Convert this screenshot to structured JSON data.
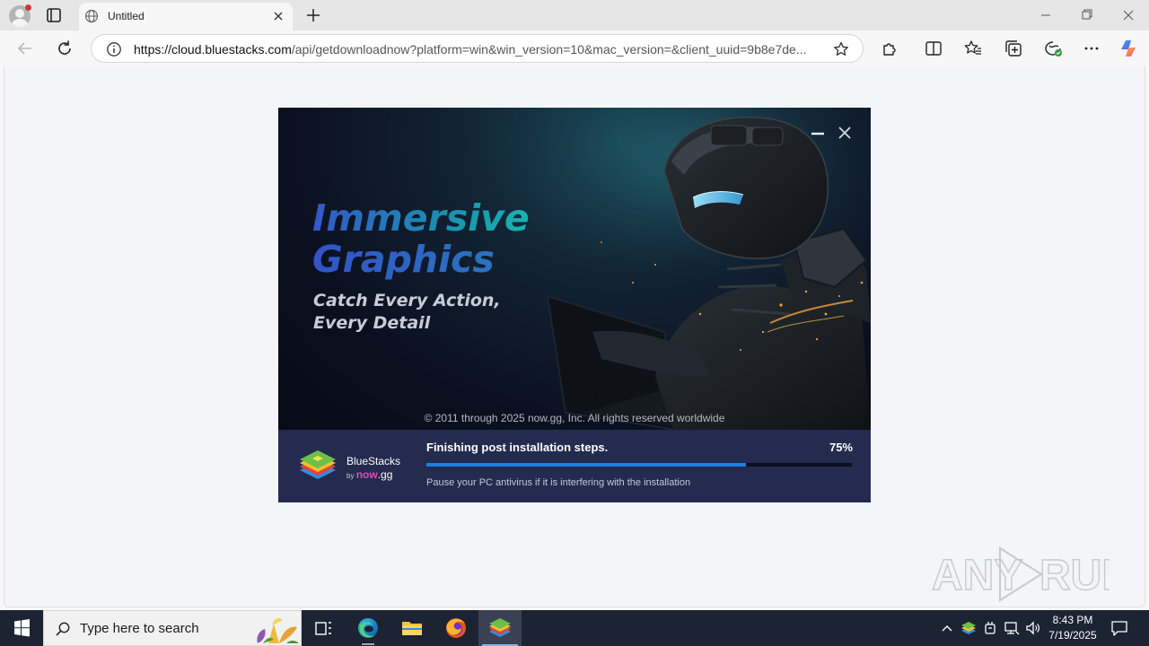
{
  "browser": {
    "tab_title": "Untitled",
    "url_host": "https://cloud.bluestacks.com",
    "url_rest": "/api/getdownloadnow?platform=win&win_version=10&mac_version=&client_uuid=9b8e7de..."
  },
  "installer": {
    "headline_line1": "Immersive",
    "headline_line2": "Graphics",
    "subline_line1": "Catch Every Action,",
    "subline_line2": "Every Detail",
    "copyright": "© 2011 through 2025 now.gg, Inc. All rights reserved worldwide",
    "brand_name": "BlueStacks",
    "brand_by": "by",
    "brand_now": "now",
    "brand_gg": ".gg",
    "status": "Finishing post installation steps.",
    "progress_label": "75%",
    "progress_fraction": 0.75,
    "hint": "Pause your PC antivirus if it is interfering with the installation"
  },
  "watermark": "ANY RUN",
  "taskbar": {
    "search_placeholder": "Type here to search",
    "time": "8:43 PM",
    "date": "7/19/2025"
  },
  "colors": {
    "progress_fill": "#1f7fe0",
    "footer_bg": "#252a4f",
    "taskbar_bg": "#1c2333"
  }
}
